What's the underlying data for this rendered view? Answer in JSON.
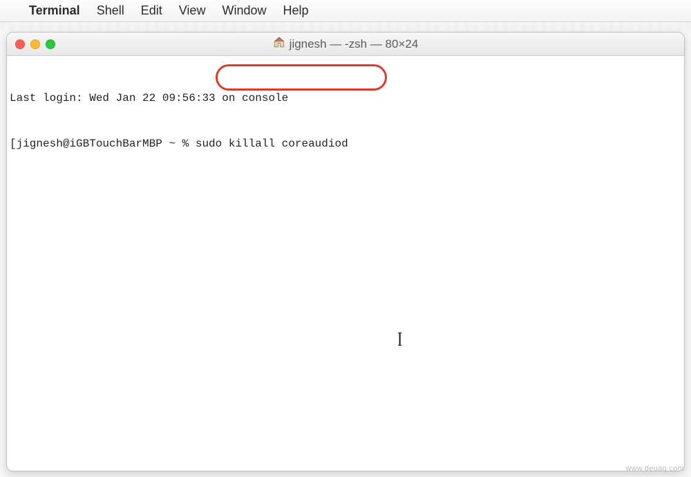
{
  "menubar": {
    "app_name": "Terminal",
    "items": [
      "Shell",
      "Edit",
      "View",
      "Window",
      "Help"
    ]
  },
  "window": {
    "title": "jignesh — -zsh — 80×24"
  },
  "terminal": {
    "last_login": "Last login: Wed Jan 22 09:56:33 on console",
    "prompt": "[jignesh@iGBTouchBarMBP ~ % ",
    "command": "sudo killall coreaudiod"
  },
  "annotation": {
    "highlight_color": "#d83a2b"
  },
  "watermark": "www.deuaq.com"
}
